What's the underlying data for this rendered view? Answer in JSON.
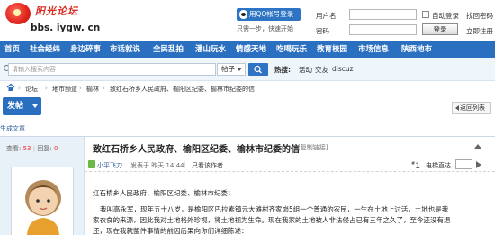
{
  "site": {
    "logo_title": "阳光论坛",
    "logo_domain": "bbs. iygw. cn"
  },
  "qq_login": {
    "button": "用QQ帐号登录",
    "note": "只需一步，快速开始"
  },
  "login": {
    "username_label": "用户名",
    "password_label": "密码",
    "auto_login": "自动登录",
    "forgot_password": "找回密码",
    "register": "立即注册",
    "login_button": "登录"
  },
  "nav": {
    "items": [
      "首页",
      "社会经纬",
      "身边碎事",
      "市话就说",
      "全民乱拍",
      "潘山玩水",
      "情感天地",
      "吃喝玩乐",
      "教育校园",
      "市场信息",
      "陕西地市"
    ]
  },
  "search": {
    "placeholder": "请输入搜索内容",
    "type": "帖子",
    "hot_label": "热搜:",
    "hot_terms": [
      "活动",
      "交友",
      "discuz"
    ]
  },
  "breadcrumb": [
    "论坛",
    "地市频道",
    "榆林",
    "致红石桥乡人民政府、榆阳区纪委、榆林市纪委的信"
  ],
  "toolbar": {
    "post_button": "发帖",
    "back_button": "返回列表"
  },
  "sub_link": "生成文章",
  "thread": {
    "stats_views_label": "查看:",
    "views": "53",
    "stats_replies_label": "回复:",
    "replies": "0",
    "title": "致红石桥乡人民政府、榆阳区纪委、榆林市纪委的信",
    "copy_link": "[复制链接]",
    "author": "小平飞刀",
    "posted": "发表于 昨天 14:44",
    "separator": "|",
    "view_author": "只看该作者",
    "floor_number": "1",
    "floor_sup": "#",
    "jump_label": "电梯直达",
    "body_lines": [
      "红石桥乡人民政府、榆阳区纪委、榆林市纪委：",
      "我叫高永军，现年五十八岁，是榆阳区巴拉素镇元大滩村齐家峁5组一个普通的农民，一生在土地上讨活，土地也是我",
      "家衣食的来源，因此我对土地格外珍视，将土地视为生命。现在我家的土地被人非法侵占已有三年之久了，至今还没有退",
      "还，现在我就整件事情的前因后果向你们详细陈述："
    ]
  },
  "colors": {
    "nav_blue": "#2b6fc0",
    "logo_red": "#d82a1e",
    "stats_highlight": "#ee3333"
  }
}
